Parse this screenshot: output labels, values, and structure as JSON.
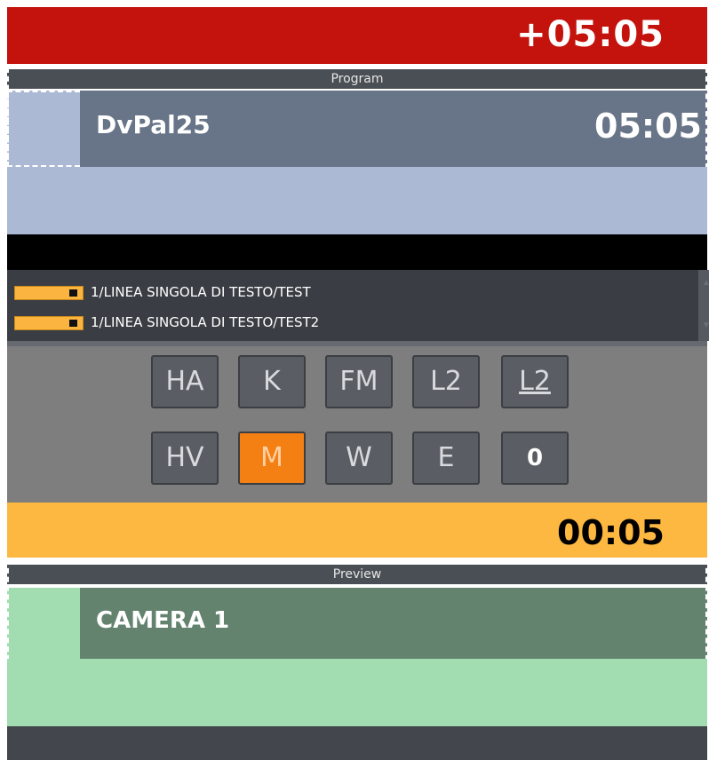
{
  "program": {
    "countdown": "+05:05",
    "section_label": "Program",
    "clip_name": "DvPal25",
    "clip_duration": "05:05"
  },
  "graphics_list": [
    {
      "label": "1/LINEA SINGOLA DI TESTO/TEST"
    },
    {
      "label": "1/LINEA SINGOLA DI TESTO/TEST2"
    }
  ],
  "buttons": {
    "row1": [
      "HA",
      "K",
      "FM",
      "L2",
      "L2"
    ],
    "row2": [
      "HV",
      "M",
      "W",
      "E",
      "0"
    ],
    "active": "M"
  },
  "cue": {
    "time": "00:05"
  },
  "preview": {
    "section_label": "Preview",
    "clip_name": "CAMERA 1"
  },
  "colors": {
    "program_red": "#c4120c",
    "program_blue": "#abb9d5",
    "cue_orange": "#fdb842",
    "active_button": "#f47f12",
    "preview_green": "#a1ddb0"
  }
}
